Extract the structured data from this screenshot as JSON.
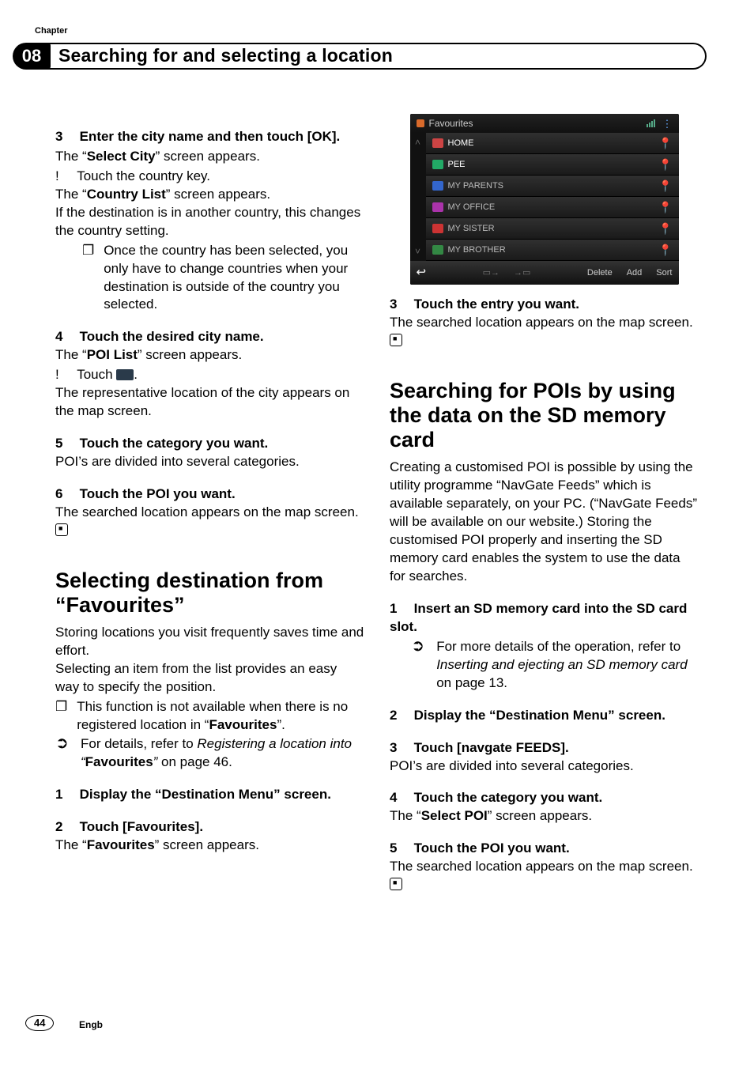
{
  "chapter_label": "Chapter",
  "chapter_number": "08",
  "chapter_title": "Searching for and selecting a location",
  "page_number": "44",
  "lang_label": "Engb",
  "left": {
    "s3_head_num": "3",
    "s3_head": "Enter the city name and then touch [OK].",
    "s3_l1a": "The “",
    "s3_l1b": "Select City",
    "s3_l1c": "” screen appears.",
    "s3_b1": "Touch the country key.",
    "s3_l2a": "The “",
    "s3_l2b": "Country List",
    "s3_l2c": "” screen appears.",
    "s3_l3": "If the destination is in another country, this changes the country setting.",
    "s3_note": "Once the country has been selected, you only have to change countries when your destination is outside of the country you selected.",
    "s4_head_num": "4",
    "s4_head": "Touch the desired city name.",
    "s4_l1a": "The “",
    "s4_l1b": "POI List",
    "s4_l1c": "” screen appears.",
    "s4_b1a": "Touch ",
    "s4_b1b": ".",
    "s4_l2": "The representative location of the city appears on the map screen.",
    "s5_head_num": "5",
    "s5_head": "Touch the category you want.",
    "s5_l1": "POI’s are divided into several categories.",
    "s6_head_num": "6",
    "s6_head": "Touch the POI you want.",
    "s6_l1": "The searched location appears on the map screen.",
    "h2a_a": "Selecting destination from “",
    "h2a_b": "Favourites",
    "h2a_c": "”",
    "fav_p1": "Storing locations you visit frequently saves time and effort.",
    "fav_p2": "Selecting an item from the list provides an easy way to specify the position.",
    "fav_note_a": "This function is not available when there is no registered location in “",
    "fav_note_b": "Favourites",
    "fav_note_c": "”.",
    "fav_xref_a": "For details, refer to ",
    "fav_xref_b": "Registering a location into “",
    "fav_xref_c": "Favourites",
    "fav_xref_d": "”",
    "fav_xref_e": " on page 46.",
    "fav_s1_num": "1",
    "fav_s1_head": "Display the “Destination Menu” screen.",
    "fav_s2_num": "2",
    "fav_s2_head": "Touch [Favourites].",
    "fav_s2_l1a": "The “",
    "fav_s2_l1b": "Favourites",
    "fav_s2_l1c": "” screen appears."
  },
  "shot": {
    "title": "Favourites",
    "rows": [
      {
        "label": "HOME",
        "icon": "ic-home",
        "hi": true
      },
      {
        "label": "PEE",
        "icon": "ic-pee",
        "hi": true
      },
      {
        "label": "MY PARENTS",
        "icon": "ic-par",
        "hi": false
      },
      {
        "label": "MY OFFICE",
        "icon": "ic-off",
        "hi": false
      },
      {
        "label": "MY SISTER",
        "icon": "ic-sis",
        "hi": false
      },
      {
        "label": "MY BROTHER",
        "icon": "ic-bro",
        "hi": false
      }
    ],
    "tb_delete": "Delete",
    "tb_add": "Add",
    "tb_sort": "Sort"
  },
  "right": {
    "s3_head_num": "3",
    "s3_head": "Touch the entry you want.",
    "s3_l1": "The searched location appears on the map screen.",
    "h2b": "Searching for POIs by using the data on the SD memory card",
    "sd_p1": "Creating a customised POI is possible by using the utility programme “NavGate Feeds” which is available separately, on your PC. (“NavGate Feeds” will be available on our website.) Storing the customised POI properly and inserting the SD memory card enables the system to use the data for searches.",
    "sd_s1_num": "1",
    "sd_s1_head": "Insert an SD memory card into the SD card slot.",
    "sd_xref_a": "For more details of the operation, refer to ",
    "sd_xref_b": "Inserting and ejecting an SD memory card",
    "sd_xref_c": " on page 13.",
    "sd_s2_num": "2",
    "sd_s2_head": "Display the “Destination Menu” screen.",
    "sd_s3_num": "3",
    "sd_s3_head": "Touch [navgate FEEDS].",
    "sd_s3_l1": "POI’s are divided into several categories.",
    "sd_s4_num": "4",
    "sd_s4_head": "Touch the category you want.",
    "sd_s4_l1a": "The “",
    "sd_s4_l1b": "Select POI",
    "sd_s4_l1c": "” screen appears.",
    "sd_s5_num": "5",
    "sd_s5_head": "Touch the POI you want.",
    "sd_s5_l1": "The searched location appears on the map screen."
  }
}
